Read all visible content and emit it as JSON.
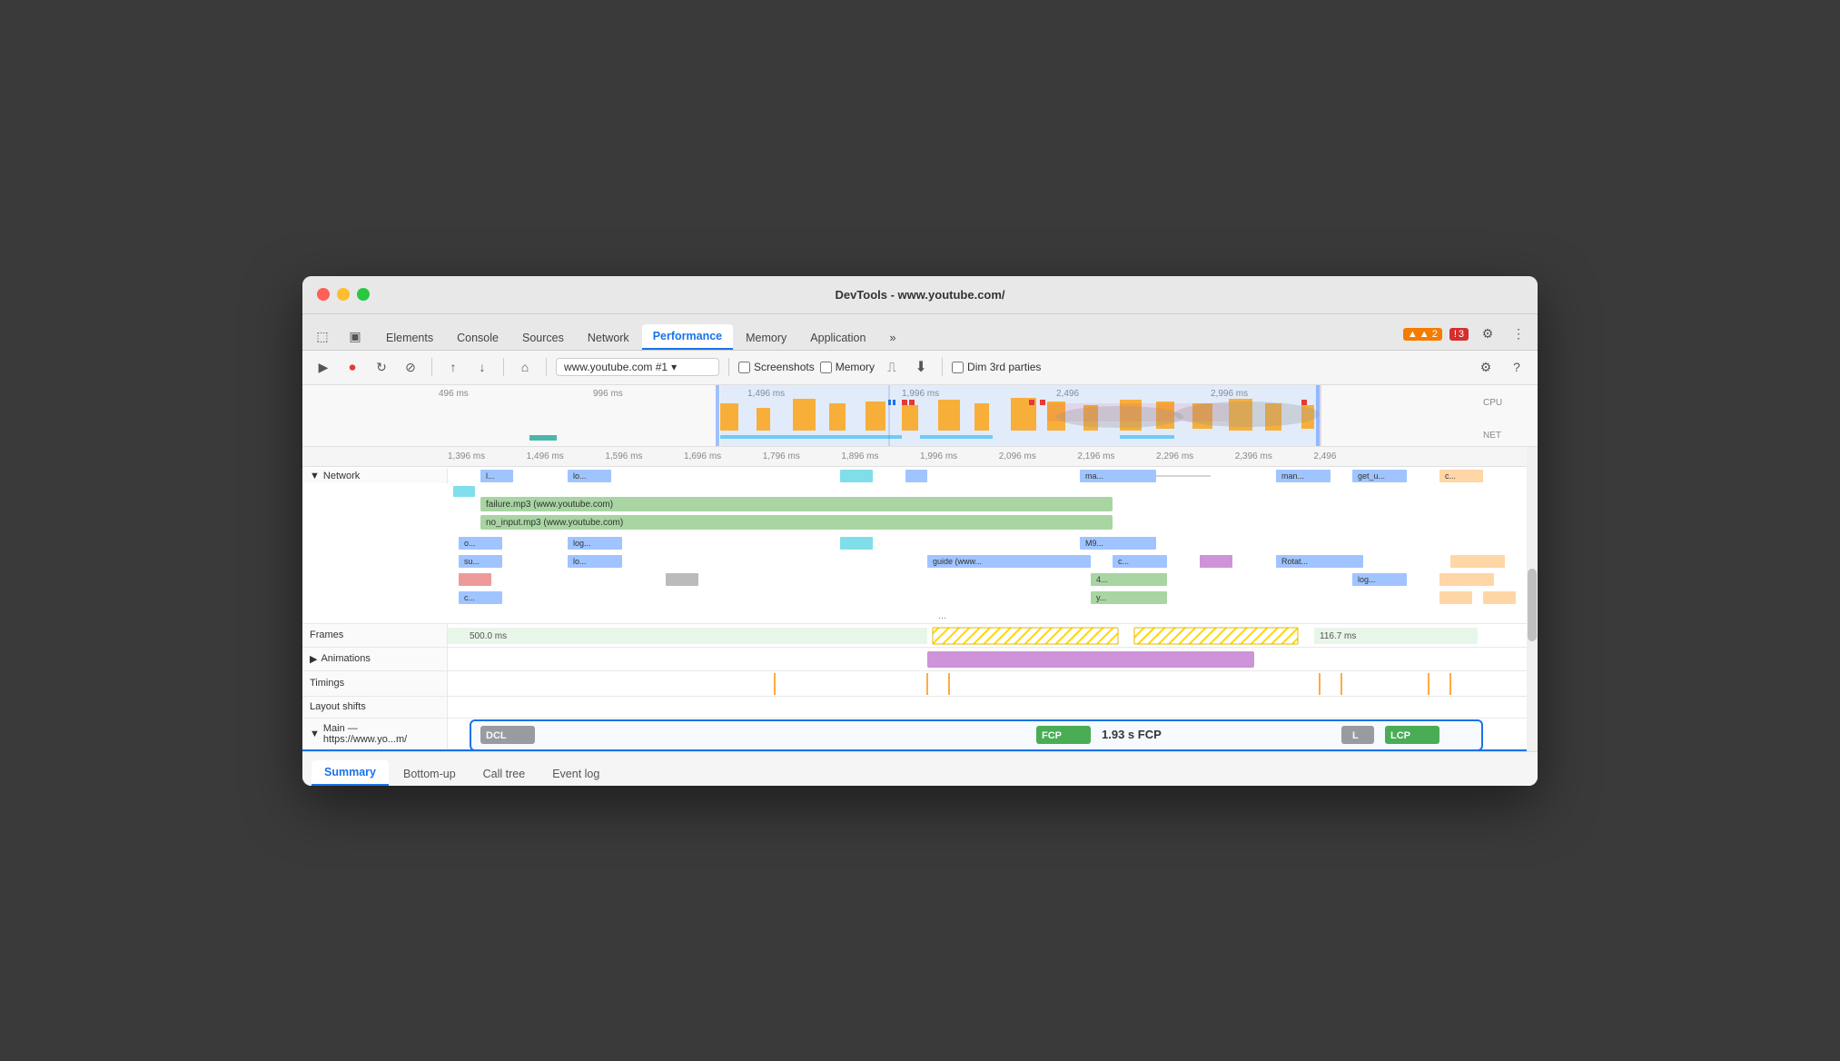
{
  "window": {
    "title": "DevTools - www.youtube.com/"
  },
  "tabs": {
    "items": [
      {
        "label": "Elements",
        "active": false
      },
      {
        "label": "Console",
        "active": false
      },
      {
        "label": "Sources",
        "active": false
      },
      {
        "label": "Network",
        "active": false
      },
      {
        "label": "Performance",
        "active": true
      },
      {
        "label": "Memory",
        "active": false
      },
      {
        "label": "Application",
        "active": false
      },
      {
        "label": "»",
        "active": false
      }
    ],
    "warnings": "▲ 2",
    "errors": "! 3"
  },
  "toolbar": {
    "url_value": "www.youtube.com #1",
    "screenshots_label": "Screenshots",
    "memory_label": "Memory",
    "dim3rd_label": "Dim 3rd parties"
  },
  "ruler": {
    "marks": [
      "1,396 ms",
      "1,496 ms",
      "1,596 ms",
      "1,696 ms",
      "1,796 ms",
      "1,896 ms",
      "1,996 ms",
      "2,096 ms",
      "2,196 ms",
      "2,296 ms",
      "2,396 ms",
      "2,496"
    ]
  },
  "overview_ruler": {
    "marks": [
      "496 ms",
      "996 ms",
      "1,496 ms",
      "1,996 ms",
      "2,496",
      "2,996 ms"
    ],
    "cpu_label": "CPU",
    "net_label": "NET"
  },
  "network": {
    "label": "▼ Network",
    "bars": [
      {
        "label": "l...",
        "color": "#a0c4ff",
        "left": "5%",
        "width": "4%"
      },
      {
        "label": "lo...",
        "color": "#a0c4ff",
        "left": "14%",
        "width": "5%"
      },
      {
        "label": "ma...",
        "color": "#a0c4ff",
        "left": "60%",
        "width": "8%"
      },
      {
        "label": "man...",
        "color": "#a0c4ff",
        "left": "78%",
        "width": "5%"
      },
      {
        "label": "get_u...",
        "color": "#a0c4ff",
        "left": "85%",
        "width": "5%"
      },
      {
        "label": "c...",
        "color": "#ffd6a5",
        "left": "93%",
        "width": "4%"
      },
      {
        "label": "failure.mp3 (www.youtube.com)",
        "color": "#a8d5a2",
        "left": "5%",
        "width": "60%",
        "tall": true
      },
      {
        "label": "no_input.mp3 (www.youtube.com)",
        "color": "#a8d5a2",
        "left": "5%",
        "width": "60%",
        "tall": true
      },
      {
        "label": "o...",
        "color": "#a0c4ff",
        "left": "2%",
        "width": "5%"
      },
      {
        "label": "log...",
        "color": "#a0c4ff",
        "left": "13%",
        "width": "5%"
      },
      {
        "label": "M9...",
        "color": "#a0c4ff",
        "left": "60%",
        "width": "8%"
      },
      {
        "label": "su...",
        "color": "#a0c4ff",
        "left": "2%",
        "width": "5%"
      },
      {
        "label": "lo...",
        "color": "#a0c4ff",
        "left": "13%",
        "width": "5%"
      },
      {
        "label": "guide (www...",
        "color": "#a0c4ff",
        "left": "46%",
        "width": "15%"
      },
      {
        "label": "c...",
        "color": "#a0c4ff",
        "left": "62%",
        "width": "5%"
      },
      {
        "label": "Rotat...",
        "color": "#a0c4ff",
        "left": "78%",
        "width": "8%"
      },
      {
        "label": "4...",
        "color": "#a8d5a2",
        "left": "60%",
        "width": "7%"
      },
      {
        "label": "log...",
        "color": "#a0c4ff",
        "left": "85%",
        "width": "5%"
      },
      {
        "label": "y...",
        "color": "#a8d5a2",
        "left": "60%",
        "width": "7%"
      },
      {
        "label": "c...",
        "color": "#a0c4ff",
        "left": "2%",
        "width": "5%"
      },
      {
        "label": "...",
        "color": "#888",
        "left": "46%",
        "width": "2%"
      }
    ]
  },
  "frames": {
    "label": "Frames",
    "segments": [
      {
        "label": "500.0 ms",
        "color": "#e8f5e9",
        "left": "0%",
        "width": "46%"
      },
      {
        "label": "",
        "color": "#ffd700",
        "left": "46%",
        "width": "18%",
        "hatched": true
      },
      {
        "label": "",
        "color": "#ffd700",
        "left": "65%",
        "width": "16%",
        "hatched": true
      },
      {
        "label": "116.7 ms",
        "color": "#e8f5e9",
        "left": "82%",
        "width": "15%"
      }
    ]
  },
  "animations": {
    "label": "▶ Animations",
    "bar": {
      "color": "#ce93d8",
      "left": "46%",
      "width": "30%"
    }
  },
  "timings": {
    "label": "Timings"
  },
  "layout_shifts": {
    "label": "Layout shifts"
  },
  "main": {
    "label": "▼ Main — https://www.yo...m/"
  },
  "timing_markers": {
    "dcl": "DCL",
    "fcp": "FCP",
    "fcp_value": "1.93 s FCP",
    "l_label": "L",
    "lcp": "LCP"
  },
  "bottom_tabs": {
    "items": [
      {
        "label": "Summary",
        "active": true
      },
      {
        "label": "Bottom-up",
        "active": false
      },
      {
        "label": "Call tree",
        "active": false
      },
      {
        "label": "Event log",
        "active": false
      }
    ]
  }
}
